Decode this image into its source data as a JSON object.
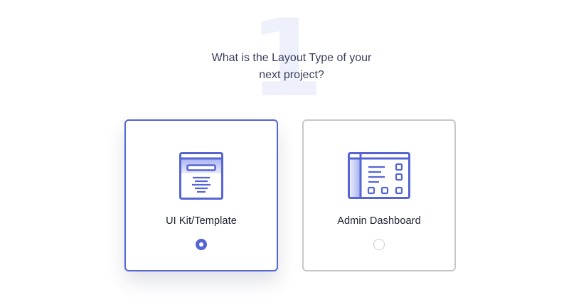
{
  "step": {
    "number": "1",
    "question_line1": "What is the Layout Type of your",
    "question_line2": "next project?"
  },
  "options": [
    {
      "label": "UI Kit/Template",
      "icon": "template-icon",
      "selected": true
    },
    {
      "label": "Admin Dashboard",
      "icon": "dashboard-icon",
      "selected": false
    }
  ],
  "colors": {
    "accent": "#5565d4",
    "accent_light": "#c5cbf3",
    "unselected_border": "#c8c8c8",
    "step_number": "#eef0fb",
    "question_text": "#3a3f5c"
  }
}
